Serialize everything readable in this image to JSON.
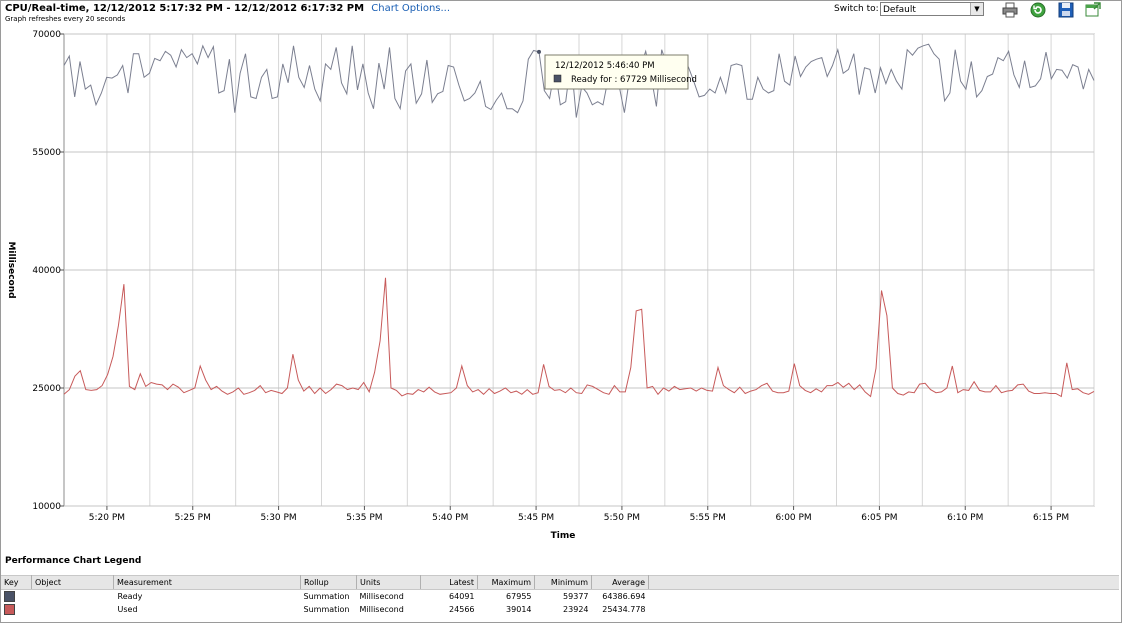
{
  "header": {
    "title": "CPU/Real-time, 12/12/2012 5:17:32 PM - 12/12/2012 6:17:32 PM",
    "chart_options_link": "Chart Options...",
    "subtitle": "Graph refreshes every 20 seconds",
    "switch_label": "Switch to:",
    "switch_value": "Default"
  },
  "toolbar": {
    "print_icon": "printer-icon",
    "refresh_icon": "refresh-icon",
    "save_icon": "save-icon",
    "popout_icon": "popout-icon"
  },
  "tooltip": {
    "time": "12/12/2012 5:46:40 PM",
    "text": "Ready for : 67729 Millisecond"
  },
  "chart_data": {
    "type": "line",
    "ylabel": "Millisecond",
    "xlabel": "Time",
    "ylim": [
      10000,
      70000
    ],
    "yticks": [
      10000,
      25000,
      40000,
      55000,
      70000
    ],
    "xlim_minutes": [
      17.5,
      77.5
    ],
    "xticks": [
      "5:20 PM",
      "5:25 PM",
      "5:30 PM",
      "5:35 PM",
      "5:40 PM",
      "5:45 PM",
      "5:50 PM",
      "5:55 PM",
      "6:00 PM",
      "6:05 PM",
      "6:10 PM",
      "6:15 PM"
    ],
    "grid": true,
    "series": [
      {
        "name": "Ready",
        "color": "#7b7f90",
        "values": [
          66000,
          67200,
          62000,
          66500,
          63000,
          63500,
          61000,
          62500,
          64500,
          64400,
          64800,
          66000,
          62500,
          67500,
          67500,
          64500,
          65000,
          66900,
          66600,
          67800,
          67300,
          65800,
          68000,
          67000,
          67500,
          66200,
          68500,
          67000,
          68400,
          62500,
          62800,
          66800,
          60000,
          65000,
          67500,
          62000,
          61800,
          64500,
          65500,
          61800,
          62000,
          66200,
          63800,
          68500,
          64500,
          63200,
          66000,
          63000,
          61500,
          66200,
          65500,
          68300,
          63800,
          62400,
          68500,
          62900,
          66200,
          62500,
          60500,
          66300,
          63000,
          68300,
          61800,
          60500,
          65300,
          66200,
          61200,
          62400,
          66700,
          61300,
          62400,
          62700,
          66000,
          65800,
          63500,
          61500,
          61800,
          62500,
          64000,
          60800,
          60400,
          61600,
          62500,
          60500,
          60500,
          60000,
          61500,
          66800,
          67900,
          67729,
          62800,
          61800,
          65700,
          61000,
          61400,
          66700,
          59377,
          63300,
          62500,
          61000,
          61400,
          61000,
          64500,
          66000,
          63500,
          60000,
          64500,
          64700,
          65800,
          67800,
          64700,
          60800,
          68000,
          66000,
          67200,
          64900,
          66500,
          65800,
          64000,
          62000,
          62200,
          63000,
          62500,
          64500,
          62500,
          66000,
          66200,
          66000,
          61700,
          61700,
          64500,
          63000,
          62500,
          62800,
          67500,
          64000,
          63500,
          67200,
          64600,
          65800,
          66500,
          66800,
          67000,
          64600,
          66000,
          68000,
          65000,
          65500,
          67500,
          62300,
          65700,
          65500,
          62500,
          65700,
          63700,
          65500,
          64000,
          63000,
          68000,
          67300,
          68200,
          68500,
          68700,
          67500,
          66800,
          61500,
          62500,
          68000,
          64000,
          63000,
          66500,
          62000,
          62800,
          64600,
          64900,
          67000,
          66600,
          67800,
          64800,
          63200,
          66600,
          63200,
          63400,
          64300,
          67700,
          64300,
          65500,
          65400,
          64400,
          66100,
          65800,
          63000,
          65500,
          64091
        ]
      },
      {
        "name": "Used",
        "color": "#c75a5a",
        "values": [
          24200,
          24800,
          26500,
          27200,
          24800,
          24700,
          24800,
          25300,
          26700,
          29000,
          33000,
          38200,
          25200,
          24800,
          26800,
          25200,
          25700,
          25500,
          25400,
          24800,
          25500,
          25100,
          24400,
          24700,
          25000,
          27800,
          26000,
          24800,
          25200,
          24600,
          24200,
          24500,
          25000,
          24200,
          24400,
          24700,
          25300,
          24400,
          24700,
          24500,
          24300,
          25000,
          29300,
          26000,
          24600,
          25200,
          24300,
          25000,
          24300,
          24800,
          25500,
          25300,
          24800,
          25000,
          24800,
          25700,
          24500,
          27000,
          31000,
          39014,
          25000,
          24700,
          24000,
          24300,
          24200,
          24800,
          24500,
          25100,
          24500,
          24200,
          24300,
          24400,
          25000,
          27800,
          25300,
          24500,
          24800,
          24200,
          24900,
          24300,
          24600,
          25000,
          24400,
          24600,
          24200,
          24800,
          24200,
          24400,
          28000,
          25200,
          24700,
          24800,
          24400,
          25000,
          24400,
          24300,
          25400,
          25200,
          24800,
          24400,
          24200,
          25300,
          24500,
          24500,
          27600,
          34800,
          35000,
          25000,
          25200,
          24200,
          25000,
          24600,
          25200,
          24800,
          24900,
          25000,
          24600,
          25000,
          24700,
          24600,
          27600,
          25300,
          24800,
          24400,
          25100,
          24300,
          24600,
          24800,
          25300,
          25600,
          24600,
          24400,
          24400,
          24600,
          28100,
          25300,
          24700,
          24400,
          24900,
          24500,
          25300,
          25300,
          25700,
          25100,
          25600,
          24800,
          25400,
          24500,
          23924,
          27500,
          37400,
          34200,
          25000,
          24300,
          24100,
          24500,
          24400,
          25500,
          25600,
          24800,
          24400,
          24500,
          25000,
          27800,
          24400,
          24800,
          24700,
          25800,
          24700,
          24500,
          24500,
          25300,
          24400,
          24600,
          24700,
          25400,
          25500,
          24600,
          24300,
          24300,
          24400,
          24300,
          24300,
          23924,
          28200,
          24800,
          24900,
          24400,
          24200,
          24566
        ]
      }
    ]
  },
  "legend": {
    "title": "Performance Chart Legend",
    "columns": [
      "Key",
      "Object",
      "Measurement",
      "Rollup",
      "Units",
      "Latest",
      "Maximum",
      "Minimum",
      "Average"
    ],
    "rows": [
      {
        "key_color": "#4a5266",
        "object": "",
        "measurement": "Ready",
        "rollup": "Summation",
        "units": "Millisecond",
        "latest": "64091",
        "maximum": "67955",
        "minimum": "59377",
        "average": "64386.694"
      },
      {
        "key_color": "#c75a5a",
        "object": "",
        "measurement": "Used",
        "rollup": "Summation",
        "units": "Millisecond",
        "latest": "24566",
        "maximum": "39014",
        "minimum": "23924",
        "average": "25434.778"
      }
    ]
  }
}
